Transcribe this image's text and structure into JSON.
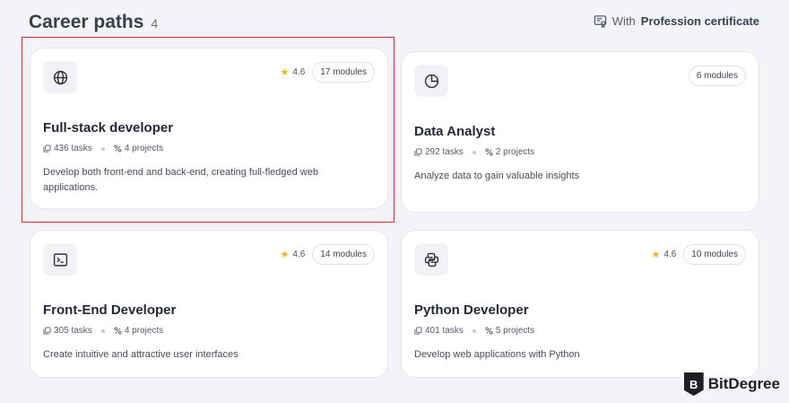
{
  "header": {
    "title": "Career paths",
    "count": "4",
    "filter_prefix": "With",
    "filter_bold": "Profession certificate",
    "filter_icon": "certificate-icon"
  },
  "cards": [
    {
      "icon": "globe-icon",
      "rating": "4.6",
      "modules": "17 modules",
      "title": "Full-stack developer",
      "tasks": "436 tasks",
      "projects": "4 projects",
      "description": "Develop both front-end and back-end, creating full-fledged web applications."
    },
    {
      "icon": "pie-chart-icon",
      "rating": "",
      "modules": "6 modules",
      "title": "Data Analyst",
      "tasks": "292 tasks",
      "projects": "2 projects",
      "description": "Analyze data to gain valuable insights"
    },
    {
      "icon": "terminal-icon",
      "rating": "4.6",
      "modules": "14 modules",
      "title": "Front-End Developer",
      "tasks": "305 tasks",
      "projects": "4 projects",
      "description": "Create intuitive and attractive user interfaces"
    },
    {
      "icon": "python-icon",
      "rating": "4.6",
      "modules": "10 modules",
      "title": "Python Developer",
      "tasks": "401 tasks",
      "projects": "5 projects",
      "description": "Develop web applications with Python"
    }
  ],
  "brand": {
    "letter": "B",
    "name": "BitDegree"
  },
  "colors": {
    "background": "#f3f4f8",
    "star": "#f2b417",
    "selection": "#d9262b"
  }
}
